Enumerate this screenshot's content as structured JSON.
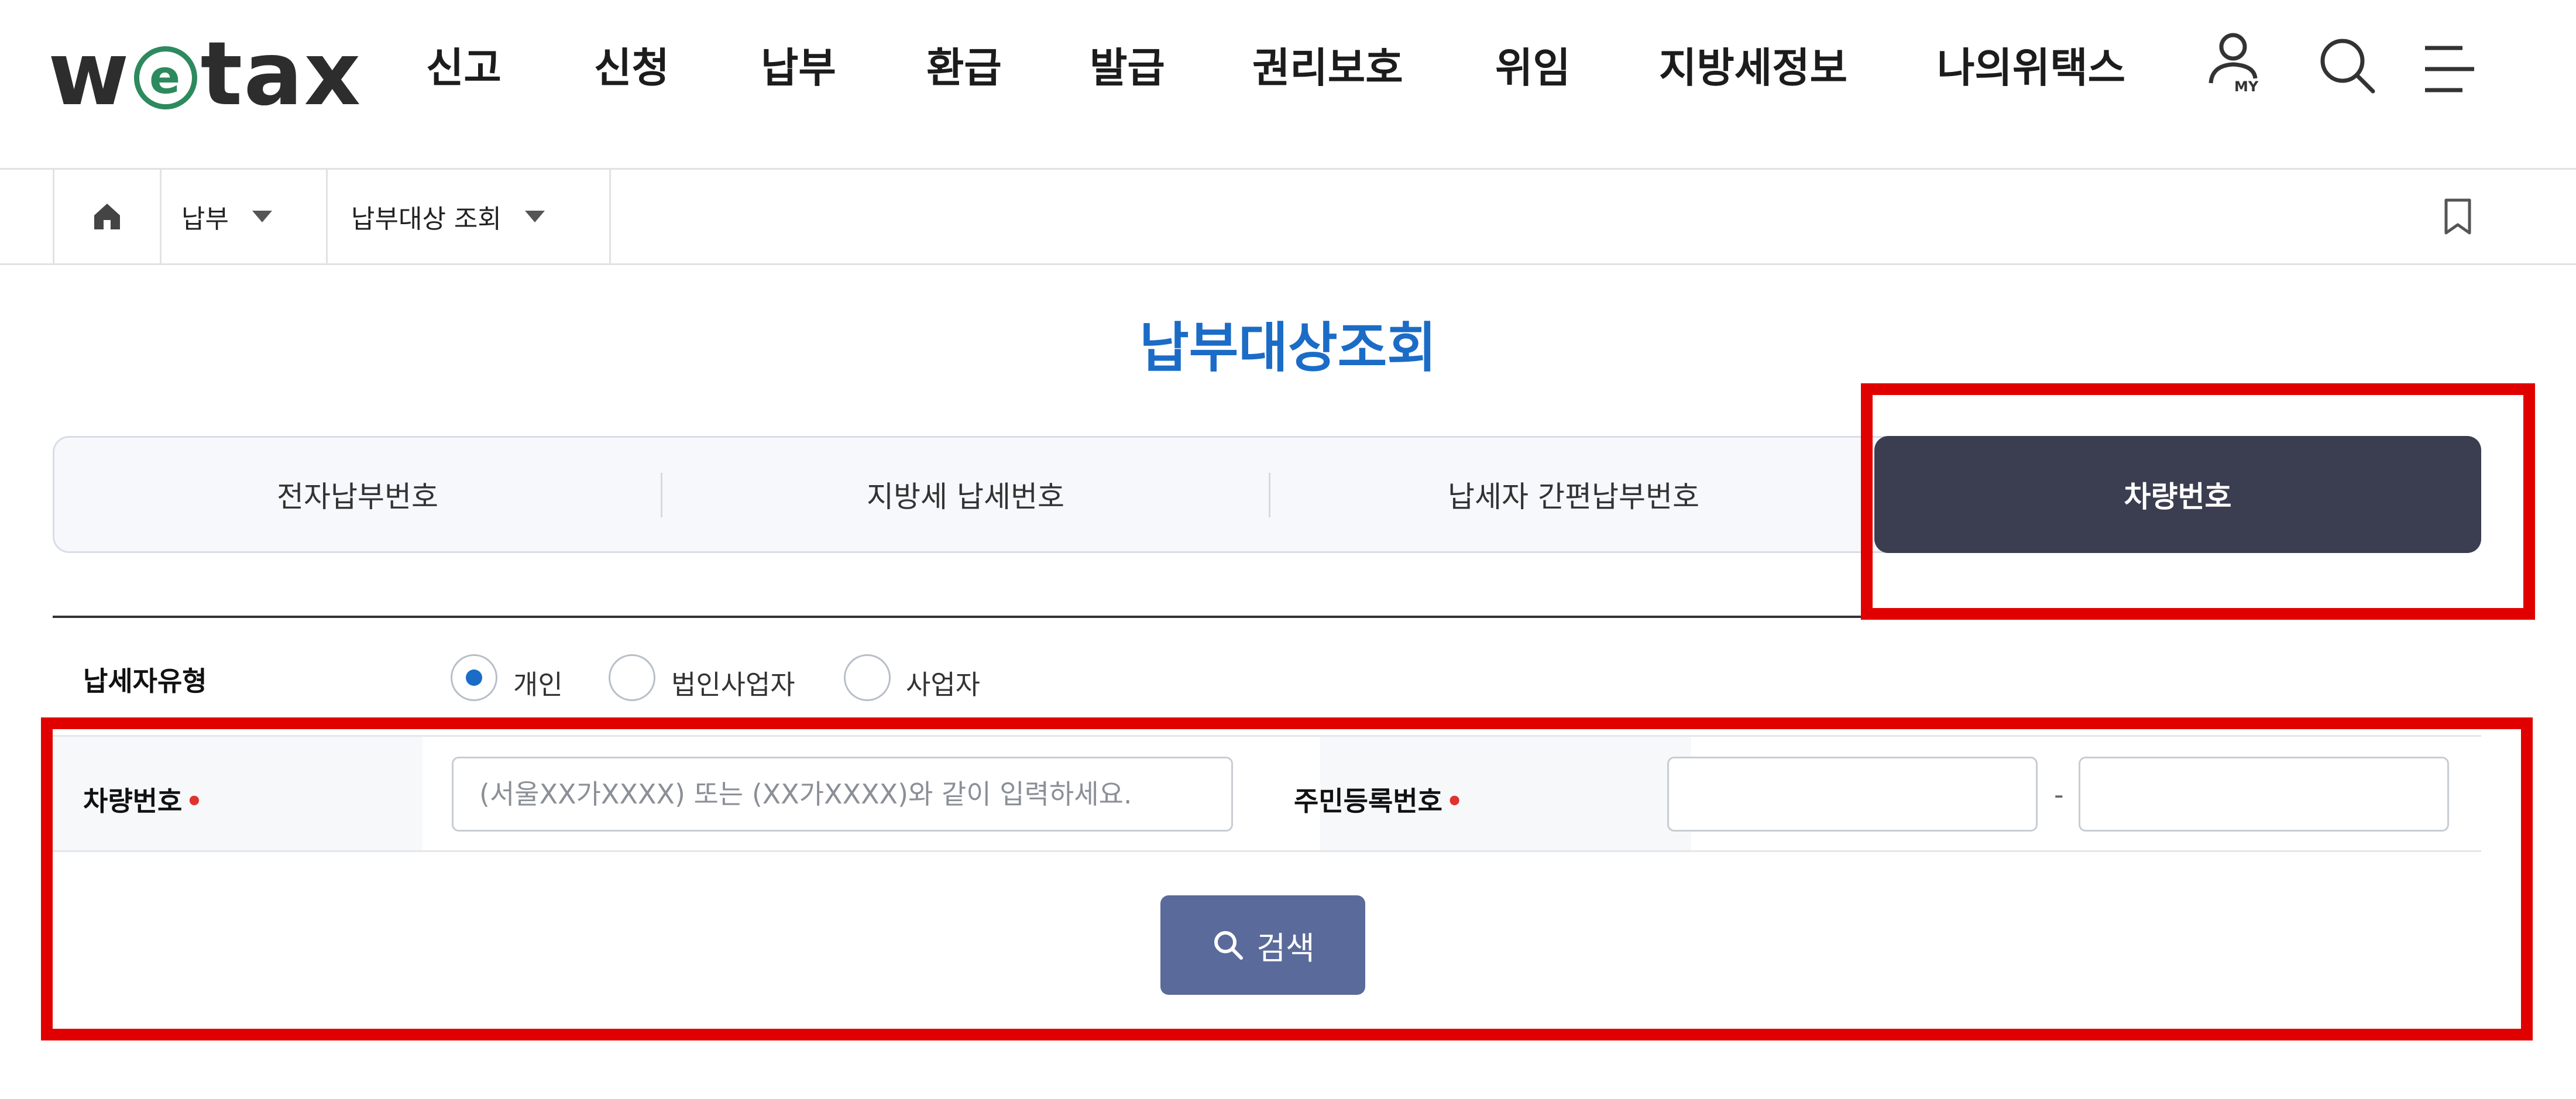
{
  "logo": {
    "text_before": "w",
    "text_e": "e",
    "text_after": "tax"
  },
  "nav": {
    "items": [
      "신고",
      "신청",
      "납부",
      "환급",
      "발급",
      "권리보호",
      "위임",
      "지방세정보",
      "나의위택스"
    ]
  },
  "header_icons": {
    "my_label": "MY",
    "user": "user-icon",
    "search": "search-icon",
    "menu": "menu-icon"
  },
  "breadcrumb": {
    "home_icon": "home-icon",
    "level1": "납부",
    "level2": "납부대상 조회",
    "bookmark_icon": "bookmark-icon"
  },
  "page": {
    "title": "납부대상조회"
  },
  "tabs": [
    {
      "label": "전자납부번호",
      "active": false
    },
    {
      "label": "지방세 납세번호",
      "active": false
    },
    {
      "label": "납세자 간편납부번호",
      "active": false
    },
    {
      "label": "차량번호",
      "active": true
    }
  ],
  "form": {
    "taxpayer_type_label": "납세자유형",
    "taxpayer_types": [
      {
        "label": "개인",
        "selected": true
      },
      {
        "label": "법인사업자",
        "selected": false
      },
      {
        "label": "사업자",
        "selected": false
      }
    ],
    "vehicle_label": "차량번호",
    "vehicle_placeholder": "(서울XX가XXXX) 또는 (XX가XXXX)와 같이 입력하세요.",
    "vehicle_value": "",
    "rrn_label": "주민등록번호",
    "rrn_front_value": "",
    "rrn_back_value": "",
    "rrn_separator": "-",
    "required_mark": "•",
    "search_button": "검색"
  },
  "colors": {
    "brand_blue": "#1b6cc6",
    "active_tab": "#3b3e50",
    "search_button": "#5a6a9b",
    "highlight": "#e00000",
    "required": "#e0322f",
    "logo_green": "#2d8a5e"
  }
}
